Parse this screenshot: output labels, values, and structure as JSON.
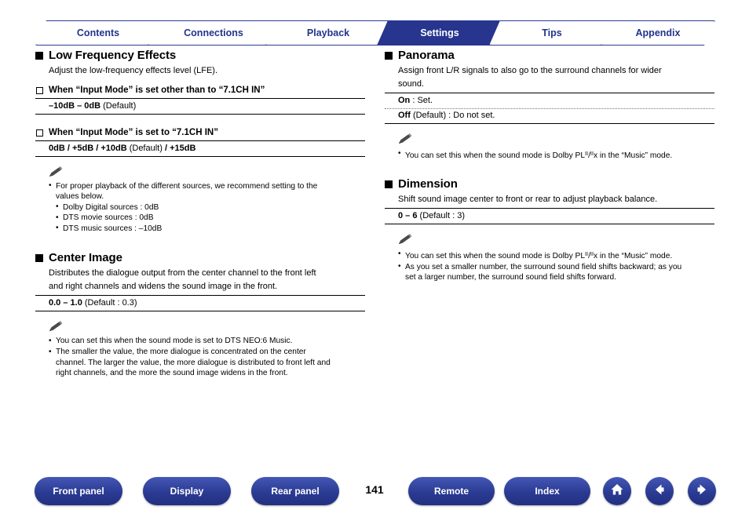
{
  "tabs": [
    {
      "label": "Contents",
      "active": false
    },
    {
      "label": "Connections",
      "active": false
    },
    {
      "label": "Playback",
      "active": false
    },
    {
      "label": "Settings",
      "active": true
    },
    {
      "label": "Tips",
      "active": false
    },
    {
      "label": "Appendix",
      "active": false
    }
  ],
  "left": {
    "lfe": {
      "title": "Low Frequency Effects",
      "desc": "Adjust the low-frequency effects level (LFE).",
      "sub1": "When “Input Mode” is set other than to “7.1CH IN”",
      "val1_bold": "–10dB – 0dB",
      "val1_rest": " (Default)",
      "sub2": "When “Input Mode” is set to “7.1CH IN”",
      "val2_bold": "0dB / +5dB / +10dB",
      "val2_mid": " (Default) ",
      "val2_bold2": "/ +15dB",
      "notes": [
        "For proper playback of the different sources, we recommend setting to the",
        "values below.",
        "Dolby Digital sources : 0dB",
        "DTS movie sources : 0dB",
        "DTS music sources : –10dB"
      ]
    },
    "center_image": {
      "title": "Center Image",
      "desc_line1": "Distributes the dialogue output from the center channel to the front left",
      "desc_line2": "and right channels and widens the sound image in the front.",
      "val_bold": "0.0 – 1.0",
      "val_rest": " (Default : 0.3)",
      "notes": [
        "You can set this when the sound mode is set to DTS NEO:6 Music.",
        "The smaller the value, the more dialogue is concentrated on the center",
        "channel. The larger the value, the more dialogue is distributed to front left and",
        "right channels, and the more the sound image widens in the front."
      ]
    }
  },
  "right": {
    "panorama": {
      "title": "Panorama",
      "desc_line1": "Assign front L/R signals to also go to the surround channels for wider",
      "desc_line2": "sound.",
      "on_bold": "On",
      "on_rest": " : Set.",
      "off_bold": "Off",
      "off_rest": " (Default) : Do not set.",
      "note_pre": "You can set this when the sound mode is Dolby PL",
      "note_sup": "II",
      "note_mid": "/",
      "note_sup2": "II",
      "note_post": "x in the “Music” mode."
    },
    "dimension": {
      "title": "Dimension",
      "desc": "Shift sound image center to front or rear to adjust playback balance.",
      "val_bold": "0 – 6",
      "val_rest": " (Default : 3)",
      "note1_pre": "You can set this when the sound mode is Dolby PL",
      "note1_sup": "II",
      "note1_mid": "/",
      "note1_sup2": "II",
      "note1_post": "x in the “Music” mode.",
      "note2_line1": "As you set a smaller number, the surround sound field shifts backward; as you",
      "note2_line2": "set a larger number, the surround sound field shifts forward."
    }
  },
  "footer": {
    "buttons": [
      {
        "label": "Front panel"
      },
      {
        "label": "Display"
      },
      {
        "label": "Rear panel"
      },
      {
        "label": "Remote"
      },
      {
        "label": "Index"
      }
    ],
    "page_number": "141",
    "icons": [
      {
        "name": "home-icon"
      },
      {
        "name": "arrow-left-icon"
      },
      {
        "name": "arrow-right-icon"
      }
    ]
  },
  "colors": {
    "brand_blue": "#27358e",
    "footer_blue": "#2b3b93"
  }
}
